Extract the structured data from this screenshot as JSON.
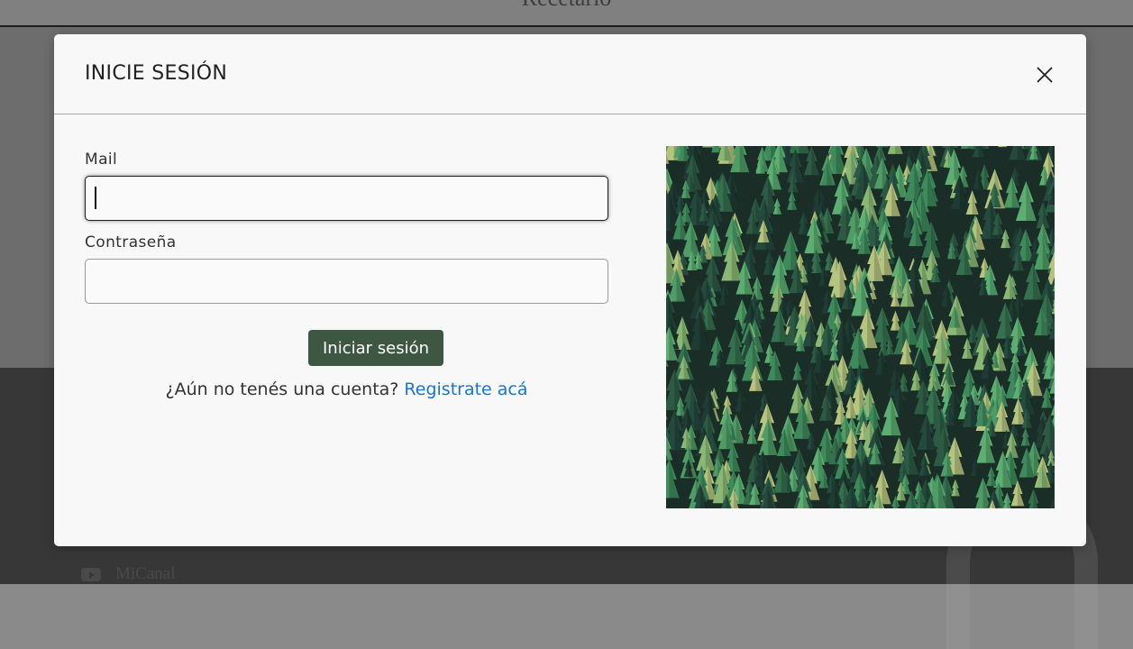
{
  "background": {
    "header_title": "Recetario",
    "footer_link": {
      "label": "MiCanal",
      "icon": "youtube-icon"
    }
  },
  "modal": {
    "title": "INICIE SESIÓN",
    "close_icon": "close-icon",
    "mail_label": "Mail",
    "mail_value": "",
    "password_label": "Contraseña",
    "password_value": "",
    "submit_label": "Iniciar sesión",
    "register_prompt": "¿Aún no tenés una cuenta?",
    "register_link": "Registrate acá",
    "image": "pine-forest-illustration"
  },
  "colors": {
    "button": "#3e5742",
    "link": "#1a75cc",
    "modal_bg": "#f8f8f8",
    "backdrop": "#000000"
  }
}
